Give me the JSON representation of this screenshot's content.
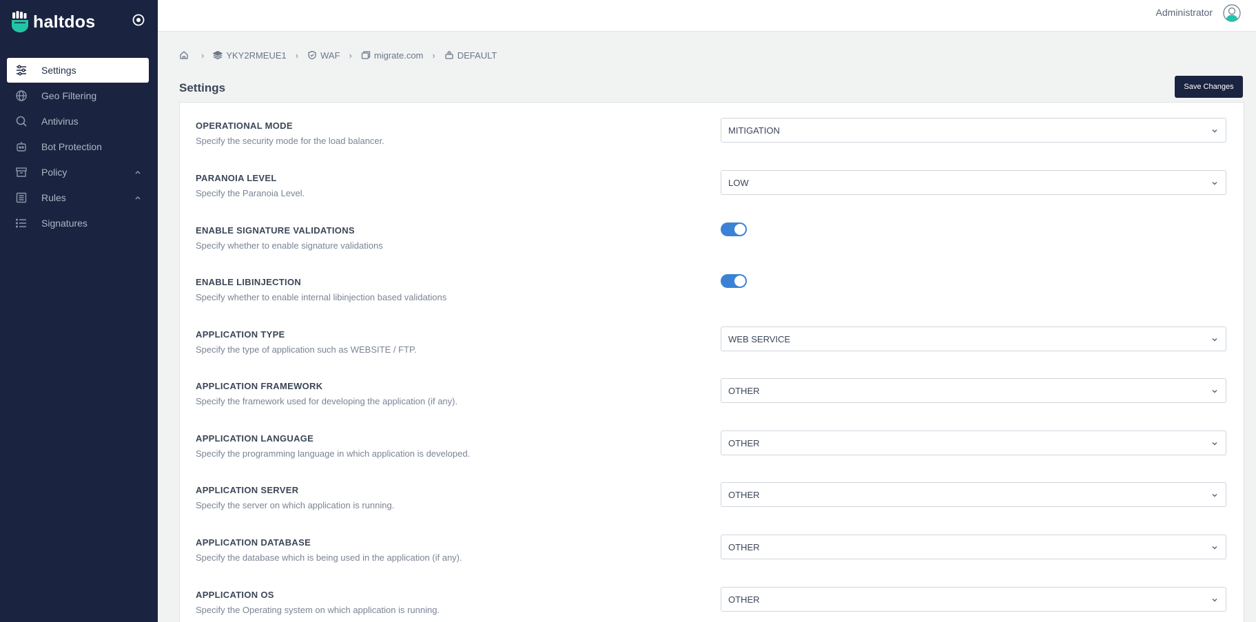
{
  "brand": {
    "name": "haltdos",
    "logo_icon": "fist-logo-icon",
    "accent": "#22c4a6"
  },
  "sidebar": {
    "toggle_icon": "target-icon",
    "items": [
      {
        "label": "Settings",
        "icon": "sliders-icon",
        "active": true
      },
      {
        "label": "Geo Filtering",
        "icon": "globe-icon"
      },
      {
        "label": "Antivirus",
        "icon": "search-icon"
      },
      {
        "label": "Bot Protection",
        "icon": "robot-icon"
      },
      {
        "label": "Policy",
        "icon": "archive-icon",
        "expandable": true
      },
      {
        "label": "Rules",
        "icon": "list-box-icon",
        "expandable": true
      },
      {
        "label": "Signatures",
        "icon": "list-icon"
      }
    ]
  },
  "header": {
    "user": "Administrator",
    "avatar_icon": "user-avatar-icon"
  },
  "breadcrumb": {
    "home_icon": "home-icon",
    "items": [
      {
        "label": "YKY2RMEUE1",
        "icon": "layers-icon"
      },
      {
        "label": "WAF",
        "icon": "shield-icon"
      },
      {
        "label": "migrate.com",
        "icon": "window-icon"
      },
      {
        "label": "DEFAULT",
        "icon": "stack-icon"
      }
    ]
  },
  "page": {
    "title": "Settings",
    "save_label": "Save Changes"
  },
  "settings": [
    {
      "label": "OPERATIONAL MODE",
      "description": "Specify the security mode for the load balancer.",
      "type": "select",
      "value": "MITIGATION"
    },
    {
      "label": "PARANOIA LEVEL",
      "description": "Specify the Paranoia Level.",
      "type": "select",
      "value": "LOW"
    },
    {
      "label": "ENABLE SIGNATURE VALIDATIONS",
      "description": "Specify whether to enable signature validations",
      "type": "toggle",
      "value": "on"
    },
    {
      "label": "ENABLE LIBINJECTION",
      "description": "Specify whether to enable internal libinjection based validations",
      "type": "toggle",
      "value": "on"
    },
    {
      "label": "APPLICATION TYPE",
      "description": "Specify the type of application such as WEBSITE / FTP.",
      "type": "select",
      "value": "WEB SERVICE"
    },
    {
      "label": "APPLICATION FRAMEWORK",
      "description": "Specify the framework used for developing the application (if any).",
      "type": "select",
      "value": "OTHER"
    },
    {
      "label": "APPLICATION LANGUAGE",
      "description": "Specify the programming language in which application is developed.",
      "type": "select",
      "value": "OTHER"
    },
    {
      "label": "APPLICATION SERVER",
      "description": "Specify the server on which application is running.",
      "type": "select",
      "value": "OTHER"
    },
    {
      "label": "APPLICATION DATABASE",
      "description": "Specify the database which is being used in the application (if any).",
      "type": "select",
      "value": "OTHER"
    },
    {
      "label": "APPLICATION OS",
      "description": "Specify the Operating system on which application is running.",
      "type": "select",
      "value": "OTHER"
    }
  ],
  "colors": {
    "sidebar_bg": "#1a2440",
    "toggle_on": "#3b82d6",
    "page_bg": "#f1f3f3"
  }
}
